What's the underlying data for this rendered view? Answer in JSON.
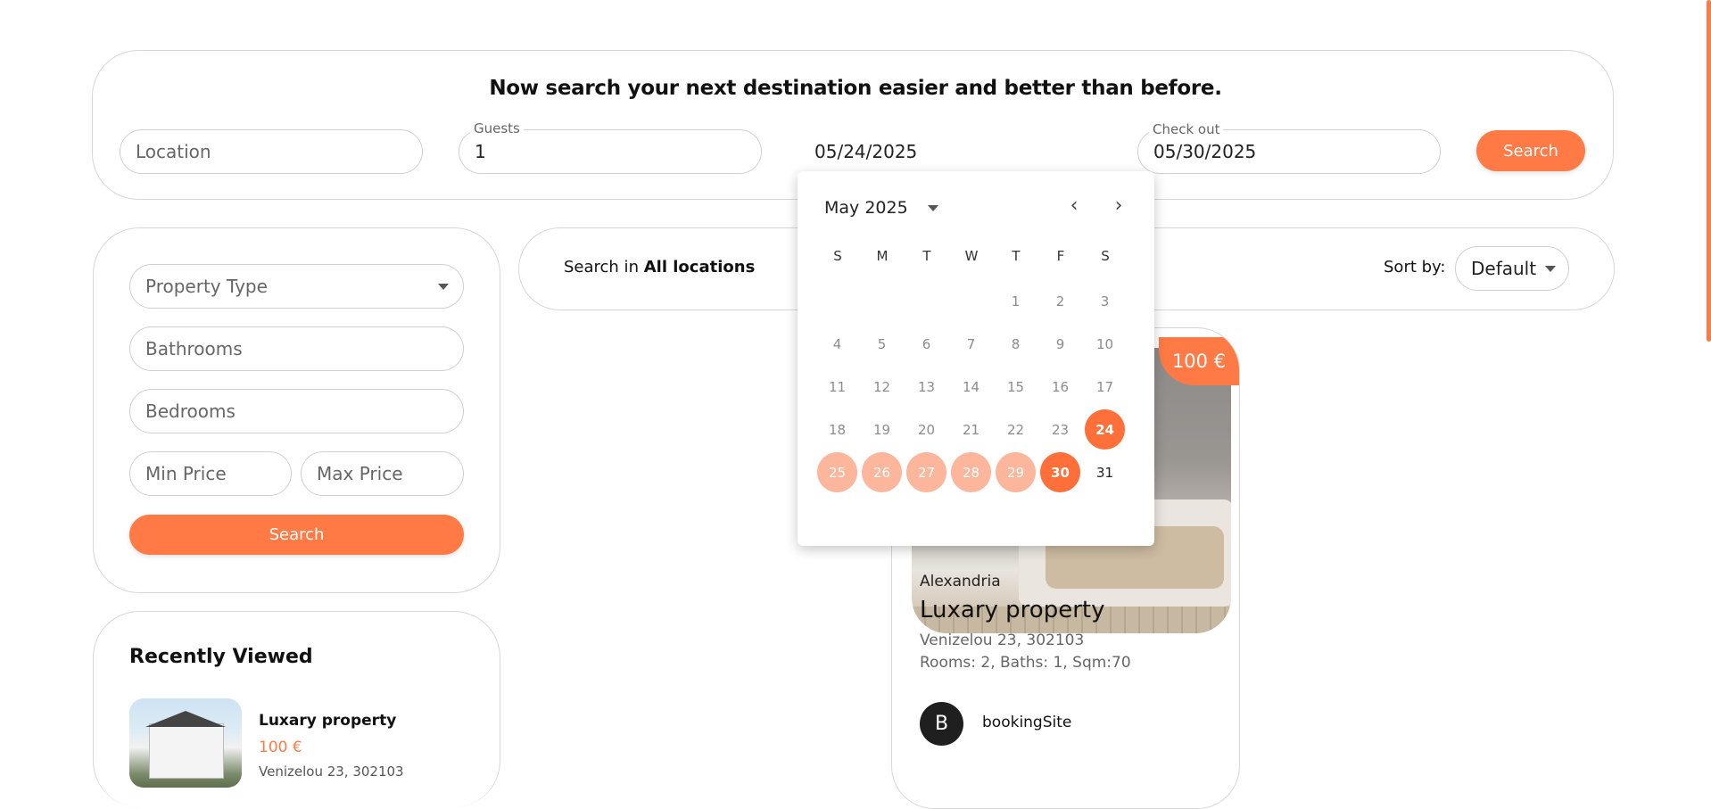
{
  "search_bar": {
    "headline": "Now search your next destination easier and better than before.",
    "location_placeholder": "Location",
    "guests_label": "Guests",
    "guests_value": "1",
    "checkin_value": "05/24/2025",
    "checkout_label": "Check out",
    "checkout_value": "05/30/2025",
    "search_label": "Search"
  },
  "calendar": {
    "month_label": "May 2025",
    "weekdays": [
      "S",
      "M",
      "T",
      "W",
      "T",
      "F",
      "S"
    ],
    "days": [
      "1",
      "2",
      "3",
      "4",
      "5",
      "6",
      "7",
      "8",
      "9",
      "10",
      "11",
      "12",
      "13",
      "14",
      "15",
      "16",
      "17",
      "18",
      "19",
      "20",
      "21",
      "22",
      "23",
      "24",
      "25",
      "26",
      "27",
      "28",
      "29",
      "30",
      "31"
    ],
    "selected_start": "24",
    "selected_end": "30"
  },
  "filters": {
    "property_type": "Property Type",
    "bathrooms": "Bathrooms",
    "bedrooms": "Bedrooms",
    "min_price": "Min Price",
    "max_price": "Max Price",
    "search_label": "Search"
  },
  "results": {
    "search_prefix": "Search in",
    "location": "All locations",
    "sort_label": "Sort by:",
    "sort_value": "Default"
  },
  "listing": {
    "price": "100 €",
    "city": "Alexandria",
    "title": "Luxary property",
    "address": "Venizelou 23, 302103",
    "details": "Rooms: 2, Baths: 1, Sqm:70",
    "host_initial": "B",
    "host_name": "bookingSite"
  },
  "recently_viewed": {
    "title": "Recently Viewed",
    "items": [
      {
        "title": "Luxary property",
        "price": "100 €",
        "address": "Venizelou 23, 302103"
      }
    ]
  },
  "colors": {
    "accent": "#ff7a45",
    "range": "#fbb69b"
  }
}
